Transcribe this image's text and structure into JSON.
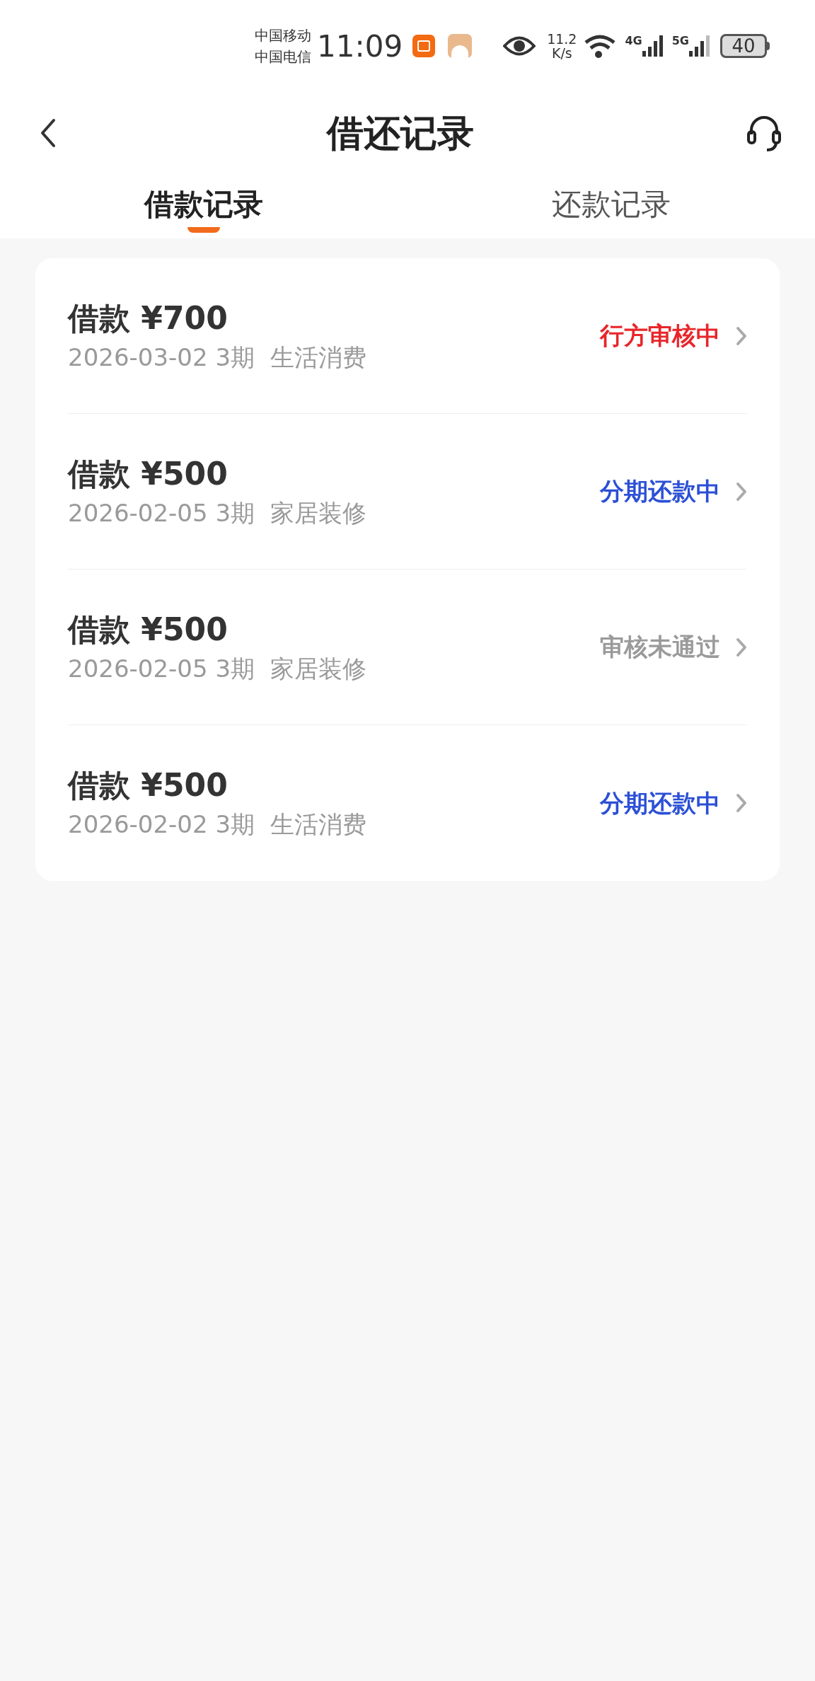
{
  "status_bar": {
    "carriers": [
      "中国移动",
      "中国电信"
    ],
    "time": "11:09",
    "speed_value": "11.2",
    "speed_unit": "K/s",
    "network_1": "4G",
    "network_2": "5G",
    "battery": "40"
  },
  "header": {
    "title": "借还记录"
  },
  "tabs": [
    {
      "label": "借款记录",
      "selected": true
    },
    {
      "label": "还款记录",
      "selected": false
    }
  ],
  "records": [
    {
      "title": "借款 ¥700",
      "details": "2026-03-02 3期  生活消费",
      "status": "行方审核中",
      "color": "#e8262a"
    },
    {
      "title": "借款 ¥500",
      "details": "2026-02-05 3期  家居装修",
      "status": "分期还款中",
      "color": "#2b4fd6"
    },
    {
      "title": "借款 ¥500",
      "details": "2026-02-05 3期  家居装修",
      "status": "审核未通过",
      "color": "#9a9a9a"
    },
    {
      "title": "借款 ¥500",
      "details": "2026-02-02 3期  生活消费",
      "status": "分期还款中",
      "color": "#2b4fd6"
    }
  ]
}
